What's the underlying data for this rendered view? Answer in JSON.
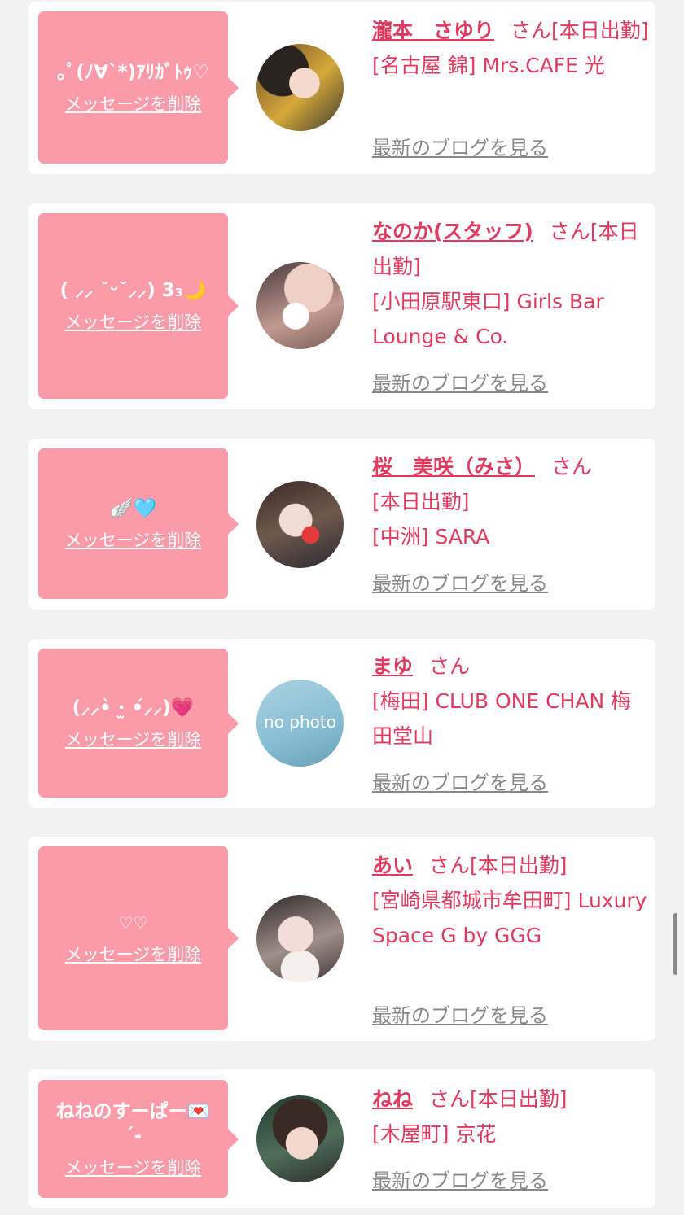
{
  "delete_label": "メッセージを削除",
  "blog_label": "最新のブログを見る",
  "san_label": "さん",
  "colors": {
    "accent": "#e03a5f",
    "bubble": "#fb9aa8",
    "link_gray": "#888888"
  },
  "items": [
    {
      "message": "｡ﾟ(ﾉ∀`*)ｱﾘｶﾞﾄｩ♡",
      "name": "瀧本　さゆり",
      "rest": "[本日出勤]",
      "shop": "[名古屋 錦] Mrs.CAFE 光"
    },
    {
      "message": "( ⸝⸝ ˘ᵕ˘⸝⸝) 3₃🌙",
      "name": "なのか(スタッフ)",
      "rest": "[本日出勤]",
      "shop": "[小田原駅東口] Girls Bar Lounge & Co."
    },
    {
      "message": "🪽🩵",
      "name": "桜　美咲（みさ）",
      "rest": "[本日出勤]",
      "shop": "[中洲] SARA"
    },
    {
      "message": "(⸝⸝•̀ ·̫ •́⸝⸝)💗",
      "name": "まゆ",
      "rest": "",
      "shop": "[梅田] CLUB ONE CHAN 梅田堂山",
      "avatar_text": "no photo"
    },
    {
      "message": "♡♡",
      "name": "あい",
      "rest": "[本日出勤]",
      "shop": "[宮崎県都城市牟田町] Luxury Space G by GGG"
    },
    {
      "message": "ねねのすーぱー💌 ´-",
      "name": "ねね",
      "rest": "[本日出勤]",
      "shop": "[木屋町] 京花"
    }
  ]
}
